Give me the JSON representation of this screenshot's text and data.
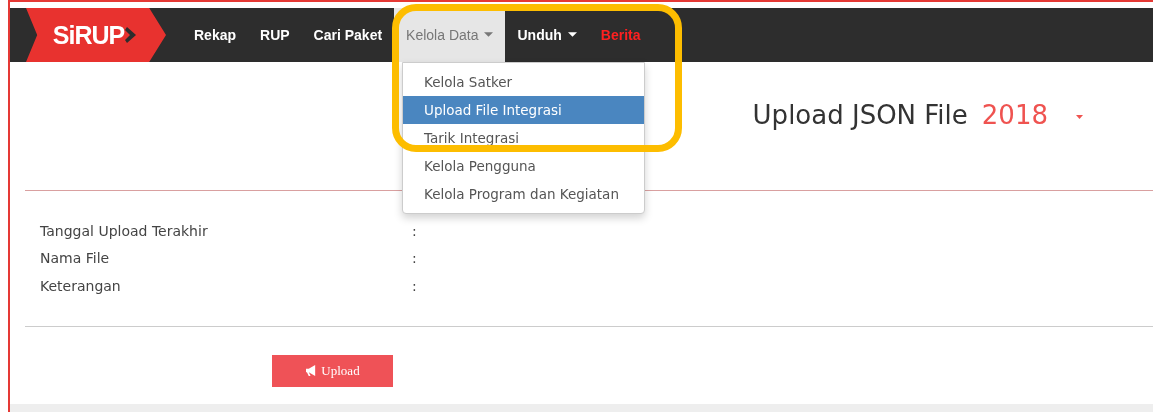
{
  "logo": {
    "text": "SiRUP"
  },
  "nav": [
    {
      "label": "Rekap",
      "kind": "link",
      "selected": false
    },
    {
      "label": "RUP",
      "kind": "link",
      "selected": false
    },
    {
      "label": "Cari Paket",
      "kind": "link",
      "selected": false
    },
    {
      "label": "Kelola Data",
      "kind": "dropdown",
      "selected": true
    },
    {
      "label": "Unduh",
      "kind": "dropdown",
      "selected": false
    },
    {
      "label": "Berita",
      "kind": "alert",
      "selected": false
    }
  ],
  "dropdown": [
    {
      "label": "Kelola Satker",
      "selected": false
    },
    {
      "label": "Upload File Integrasi",
      "selected": true
    },
    {
      "label": "Tarik Integrasi",
      "selected": false
    },
    {
      "label": "Kelola Pengguna",
      "selected": false
    },
    {
      "label": "Kelola Program dan Kegiatan",
      "selected": false
    }
  ],
  "heading": {
    "title": "Upload JSON File",
    "year": "2018"
  },
  "fields": [
    {
      "label": "Tanggal Upload Terakhir",
      "separator": ":"
    },
    {
      "label": "Nama File",
      "separator": ":"
    },
    {
      "label": "Keterangan",
      "separator": ":"
    }
  ],
  "upload_button": {
    "label": "Upload"
  }
}
